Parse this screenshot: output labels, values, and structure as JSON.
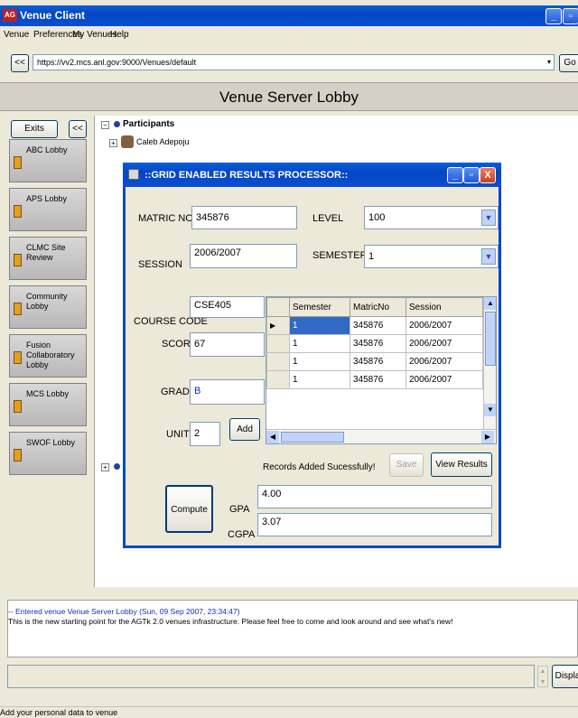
{
  "app": {
    "logo": "AG",
    "title": "Venue Client"
  },
  "menu": [
    "Venue",
    "Preferences",
    "My Venues",
    "Help"
  ],
  "address": {
    "back": "<<",
    "url": "https://vv2.mcs.anl.gov:9000/Venues/default",
    "go": "Go"
  },
  "venue_title": "Venue Server Lobby",
  "sidebar": {
    "exits": "Exits",
    "collapse": "<<",
    "lobbies": [
      "ABC Lobby",
      "APS Lobby",
      "CLMC Site Review",
      "Community Lobby",
      "Fusion Collaboratory Lobby",
      "MCS Lobby",
      "SWOF Lobby"
    ]
  },
  "tree": {
    "participants": "Participants",
    "person": "Caleb Adepoju"
  },
  "dialog": {
    "title": "::GRID ENABLED RESULTS PROCESSOR::",
    "matric_label": "MATRIC NO",
    "matric_value": "345876",
    "level_label": "LEVEL",
    "level_value": "100",
    "session_label": "SESSION",
    "session_value": "2006/2007",
    "semester_label": "SEMESTER",
    "semester_value": "1",
    "course_label": "COURSE CODE",
    "course_value": "CSE405",
    "score_label": "SCORE",
    "score_value": "67",
    "grade_label": "GRADE",
    "grade_value": "B",
    "unit_label": "UNIT",
    "unit_value": "2",
    "add": "Add",
    "table": {
      "headers": [
        "Semester",
        "MatricNo",
        "Session"
      ],
      "rows": [
        [
          "1",
          "345876",
          "2006/2007"
        ],
        [
          "1",
          "345876",
          "2006/2007"
        ],
        [
          "1",
          "345876",
          "2006/2007"
        ],
        [
          "1",
          "345876",
          "2006/2007"
        ]
      ]
    },
    "status": "Records Added Sucessfully!",
    "save": "Save",
    "view": "View Results",
    "compute": "Compute",
    "gpa_label": "GPA",
    "gpa_value": "4.00",
    "cgpa_label": "CGPA",
    "cgpa_value": "3.07"
  },
  "log": {
    "line1": "-- Entered venue Venue Server Lobby (Sun, 09 Sep 2007, 23:34:47)",
    "line2": "This is the new starting point for the AGTk 2.0 venues infrastructure. Please feel free to come and look around and see what's new!"
  },
  "display": "Display",
  "statusbar": "Add your personal data to venue"
}
